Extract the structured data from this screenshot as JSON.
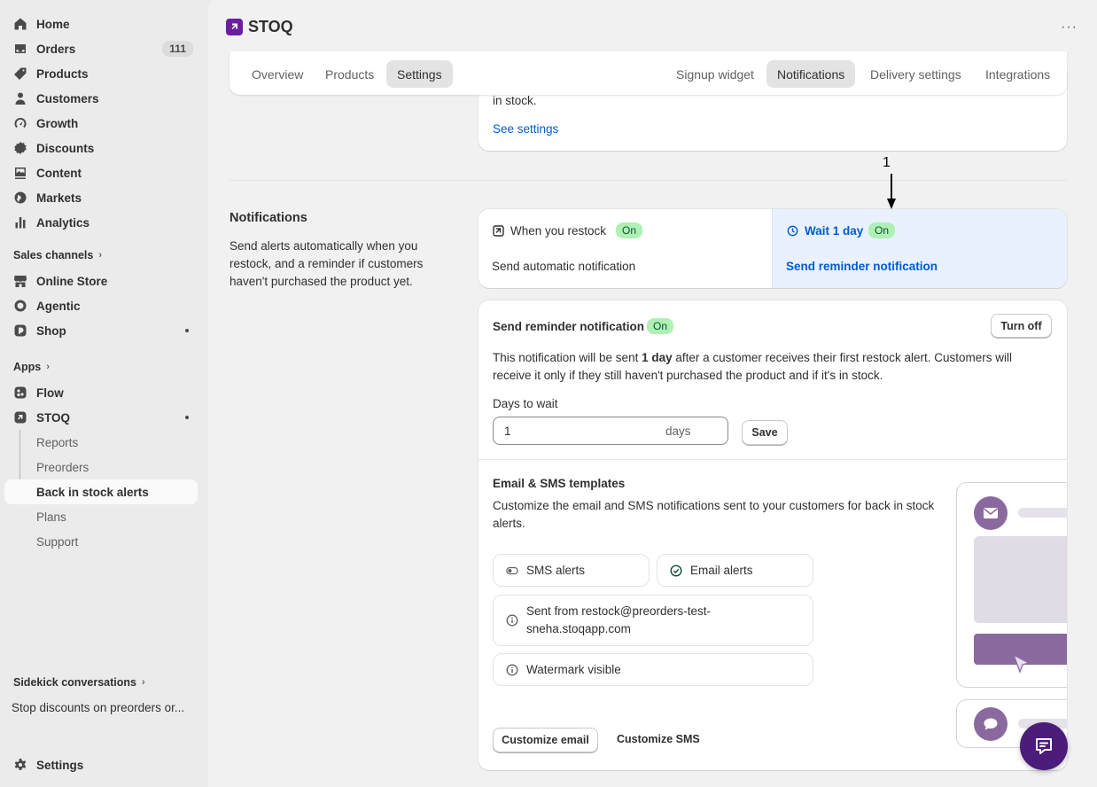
{
  "sidebar": {
    "items": [
      {
        "label": "Home",
        "icon": "home-icon"
      },
      {
        "label": "Orders",
        "icon": "inbox-icon",
        "badge": "111"
      },
      {
        "label": "Products",
        "icon": "tag-icon"
      },
      {
        "label": "Customers",
        "icon": "person-icon"
      },
      {
        "label": "Growth",
        "icon": "gauge-icon"
      },
      {
        "label": "Discounts",
        "icon": "discount-icon"
      },
      {
        "label": "Content",
        "icon": "image-icon"
      },
      {
        "label": "Markets",
        "icon": "globe-icon"
      },
      {
        "label": "Analytics",
        "icon": "bar-chart-icon"
      }
    ],
    "sales_channels_label": "Sales channels",
    "channels": [
      {
        "label": "Online Store"
      },
      {
        "label": "Agentic"
      },
      {
        "label": "Shop"
      }
    ],
    "apps_label": "Apps",
    "apps": [
      {
        "label": "Flow"
      },
      {
        "label": "STOQ"
      }
    ],
    "stoq_sub": [
      {
        "label": "Reports"
      },
      {
        "label": "Preorders"
      },
      {
        "label": "Back in stock alerts"
      },
      {
        "label": "Plans"
      },
      {
        "label": "Support"
      }
    ],
    "sidekick_label": "Sidekick conversations",
    "sidekick_item": "Stop discounts on preorders or...",
    "settings_label": "Settings"
  },
  "header": {
    "app_title": "STOQ",
    "more": "···"
  },
  "tabs_left": [
    "Overview",
    "Products",
    "Settings"
  ],
  "tabs_right": [
    "Signup widget",
    "Notifications",
    "Delivery settings",
    "Integrations"
  ],
  "top_card": {
    "text": "in stock.",
    "link": "See settings"
  },
  "annotation": {
    "number": "1"
  },
  "notifications_section": {
    "title": "Notifications",
    "description": "Send alerts automatically when you restock, and a reminder if customers haven't purchased the product yet."
  },
  "flow": {
    "step1": {
      "label": "When you restock",
      "status": "On",
      "sub": "Send automatic notification"
    },
    "step2": {
      "label": "Wait 1 day",
      "status": "On",
      "sub": "Send reminder notification"
    }
  },
  "reminder": {
    "title": "Send reminder notification",
    "status": "On",
    "turn_off": "Turn off",
    "desc_before": "This notification will be sent ",
    "desc_bold": "1 day",
    "desc_after": " after a customer receives their first restock alert. Customers will receive it only if they still haven't purchased the product and if it's in stock.",
    "days_label": "Days to wait",
    "days_value": "1",
    "days_suffix": "days",
    "save": "Save"
  },
  "templates": {
    "title": "Email & SMS templates",
    "desc": "Customize the email and SMS notifications sent to your customers for back in stock alerts.",
    "sms_alerts": "SMS alerts",
    "email_alerts": "Email alerts",
    "sent_from": "Sent from restock@preorders-test-sneha.stoqapp.com",
    "watermark": "Watermark visible",
    "customize_email": "Customize email",
    "customize_sms": "Customize SMS"
  },
  "colors": {
    "accent": "#005bd3",
    "brand": "#6b1fa0",
    "on_badge": "#aff0b5",
    "highlight": "#e8f1fd",
    "preview_purple": "#8a6a9e"
  }
}
